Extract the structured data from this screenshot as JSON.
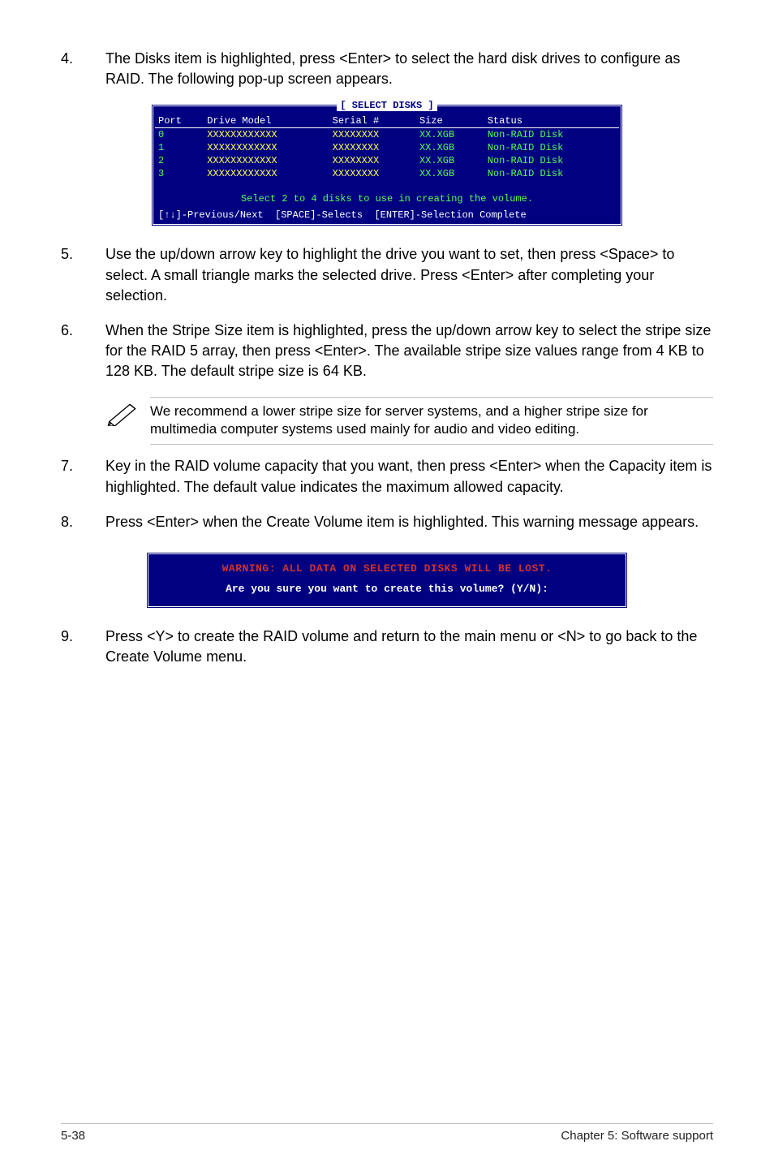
{
  "steps": {
    "s4": {
      "num": "4.",
      "text": "The Disks item is highlighted, press <Enter> to select the hard disk drives to configure as RAID. The following pop-up screen appears."
    },
    "s5": {
      "num": "5.",
      "text": "Use the up/down arrow key to highlight the drive you want to set, then press <Space> to select. A small triangle marks the selected drive. Press <Enter> after completing your selection."
    },
    "s6": {
      "num": "6.",
      "text": "When the Stripe Size item is highlighted, press the up/down arrow key to select the stripe size for the RAID 5 array, then press <Enter>. The available stripe size values range from 4 KB to 128 KB. The default stripe size is 64 KB."
    },
    "s7": {
      "num": "7.",
      "text": "Key in the RAID volume capacity that you want, then press <Enter> when the Capacity item is highlighted. The default value indicates the maximum allowed capacity."
    },
    "s8": {
      "num": "8.",
      "text": "Press <Enter> when the Create Volume item is highlighted. This warning message appears."
    },
    "s9": {
      "num": "9.",
      "text": "Press <Y> to create the RAID volume and return to the main menu or <N> to go back to the Create Volume menu."
    }
  },
  "note": "We recommend a lower stripe size for server systems, and a higher stripe size for multimedia computer systems used mainly for audio and video editing.",
  "bios": {
    "title": "[ SELECT DISKS ]",
    "headers": {
      "port": "Port",
      "model": "Drive Model",
      "serial": "Serial #",
      "size": "Size",
      "status": "Status"
    },
    "rows": [
      {
        "port": "0",
        "model": "XXXXXXXXXXXX",
        "serial": "XXXXXXXX",
        "size": "XX.XGB",
        "status": "Non-RAID Disk"
      },
      {
        "port": "1",
        "model": "XXXXXXXXXXXX",
        "serial": "XXXXXXXX",
        "size": "XX.XGB",
        "status": "Non-RAID Disk"
      },
      {
        "port": "2",
        "model": "XXXXXXXXXXXX",
        "serial": "XXXXXXXX",
        "size": "XX.XGB",
        "status": "Non-RAID Disk"
      },
      {
        "port": "3",
        "model": "XXXXXXXXXXXX",
        "serial": "XXXXXXXX",
        "size": "XX.XGB",
        "status": "Non-RAID Disk"
      }
    ],
    "msg": "Select 2 to 4 disks to use in creating the volume.",
    "footer": "[↑↓]-Previous/Next  [SPACE]-Selects  [ENTER]-Selection Complete"
  },
  "warning": {
    "l1": "WARNING: ALL DATA ON SELECTED DISKS WILL BE LOST.",
    "l2": "Are you sure you want to create this volume? (Y/N):"
  },
  "footer": {
    "left": "5-38",
    "right": "Chapter 5: Software support"
  }
}
